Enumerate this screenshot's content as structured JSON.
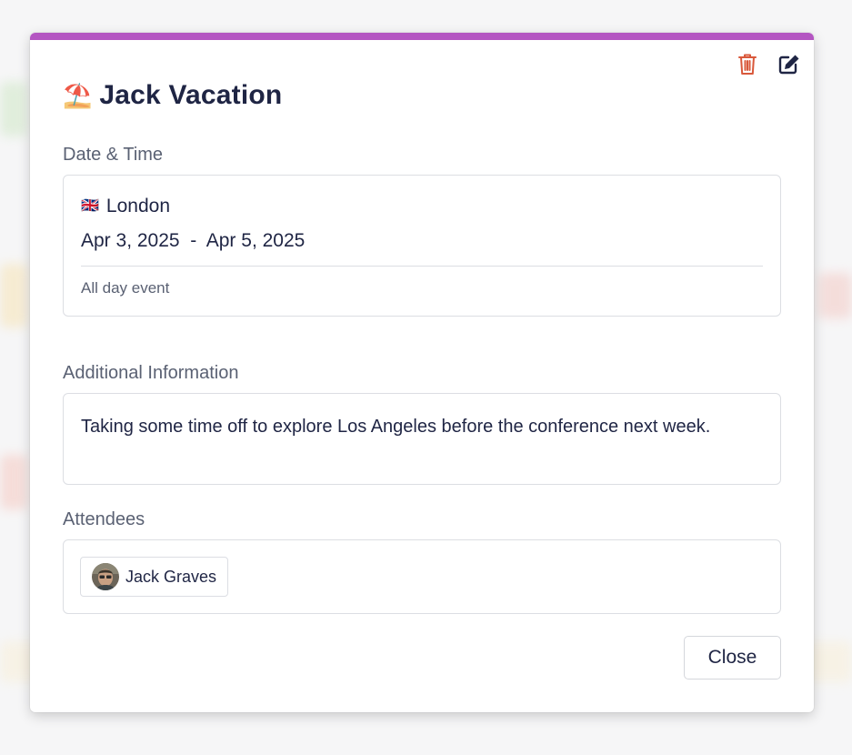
{
  "event": {
    "emoji": "⛱️",
    "title": "Jack Vacation",
    "accent_color": "#b455c2"
  },
  "actions": {
    "delete_icon": "trash-icon",
    "edit_icon": "edit-icon",
    "delete_color": "#d9583b"
  },
  "date_time": {
    "label": "Date & Time",
    "flag": "🇬🇧",
    "location": "London",
    "range": "Apr 3, 2025  -  Apr 5, 2025",
    "all_day": "All day event"
  },
  "additional_info": {
    "label": "Additional Information",
    "text": "Taking some time off to explore Los Angeles before the conference next week."
  },
  "attendees": {
    "label": "Attendees",
    "items": [
      {
        "name": "Jack Graves",
        "avatar": "avatar-photo"
      }
    ]
  },
  "footer": {
    "close_label": "Close"
  }
}
